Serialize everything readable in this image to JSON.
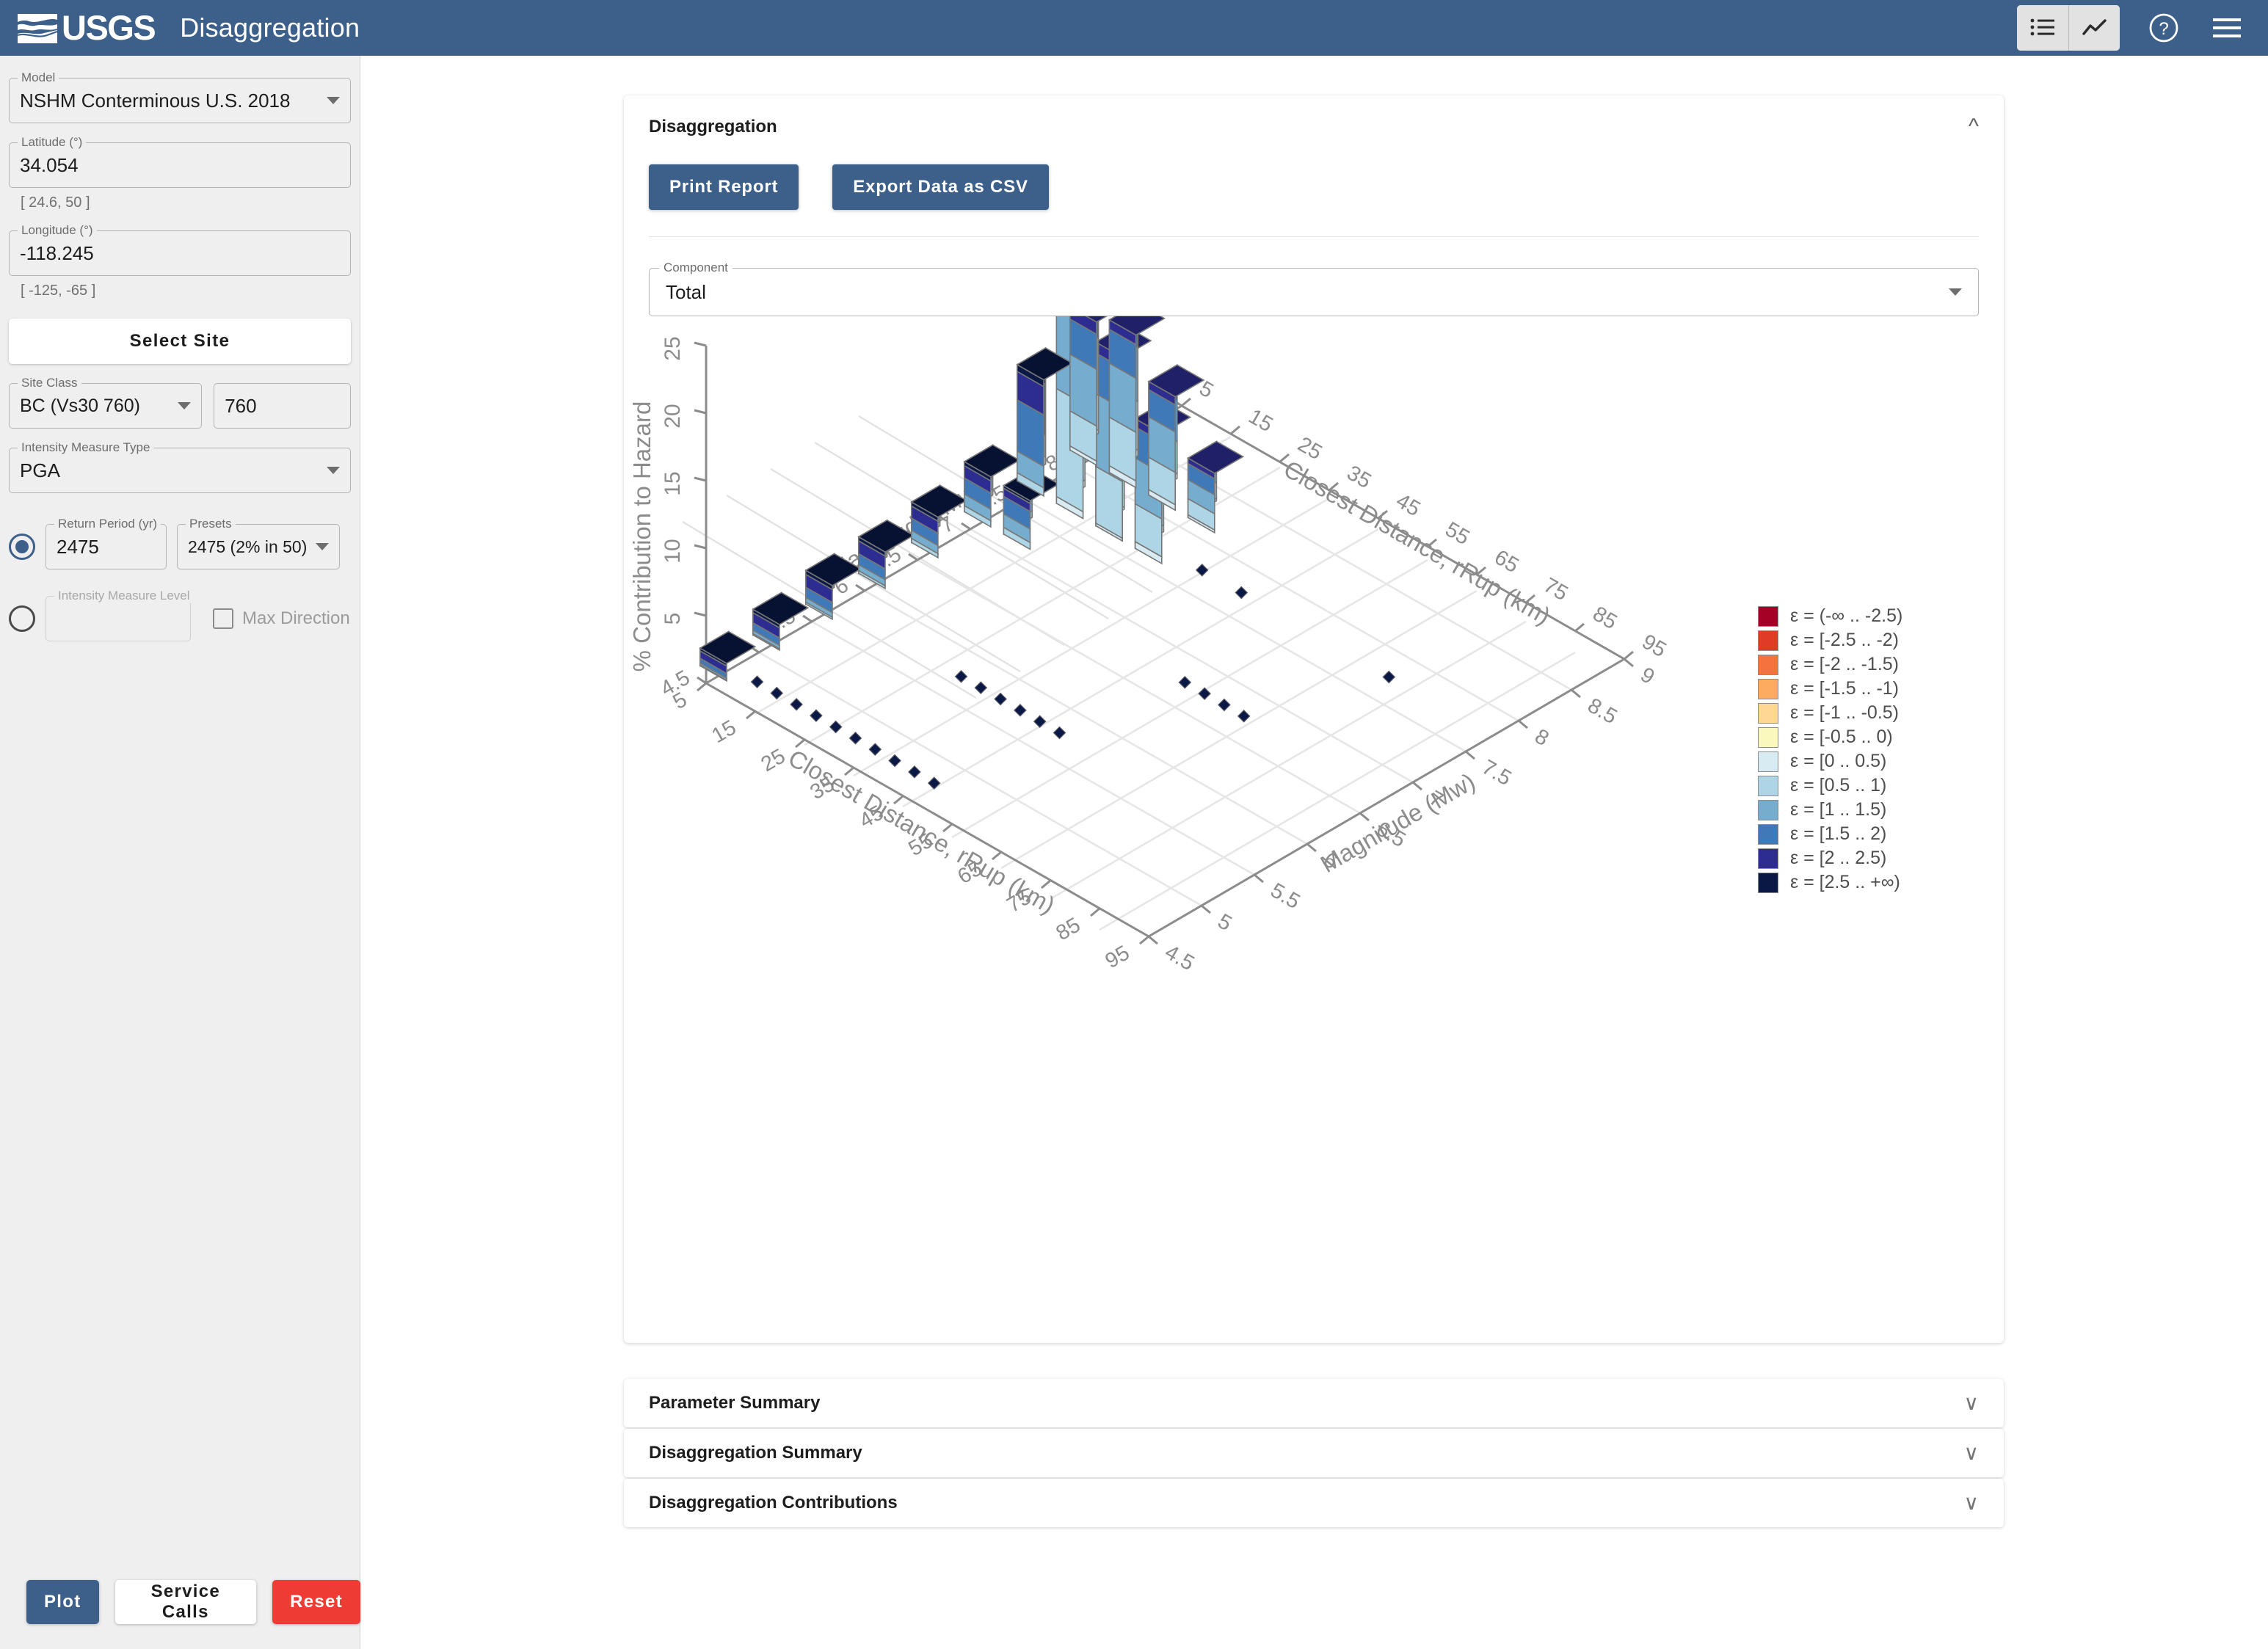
{
  "header": {
    "logo_text": "USGS",
    "title": "Disaggregation",
    "view_toggle": [
      {
        "name": "list-view",
        "icon": "list-icon",
        "active": true
      },
      {
        "name": "chart-view",
        "icon": "line-chart-icon",
        "active": false
      }
    ],
    "help_icon": "help-circle-icon",
    "menu_icon": "hamburger-menu-icon"
  },
  "sidebar": {
    "model": {
      "label": "Model",
      "value": "NSHM Conterminous U.S. 2018"
    },
    "latitude": {
      "label": "Latitude (°)",
      "value": "34.054",
      "hint": "[ 24.6, 50 ]"
    },
    "longitude": {
      "label": "Longitude (°)",
      "value": "-118.245",
      "hint": "[ -125, -65 ]"
    },
    "select_site_label": "Select Site",
    "site_class": {
      "label": "Site Class",
      "value": "BC (Vs30 760)"
    },
    "vs30": {
      "value": "760"
    },
    "imt": {
      "label": "Intensity Measure Type",
      "value": "PGA"
    },
    "return_period": {
      "label": "Return Period (yr)",
      "value": "2475",
      "selected": true
    },
    "presets": {
      "label": "Presets",
      "value": "2475 (2% in 50)"
    },
    "iml": {
      "label": "Intensity Measure Level",
      "value": "",
      "selected": false
    },
    "max_direction": {
      "label": "Max Direction",
      "checked": false
    },
    "footer": {
      "plot_label": "Plot",
      "service_calls_label": "Service Calls",
      "reset_label": "Reset"
    }
  },
  "main": {
    "disagg_card": {
      "title": "Disaggregation",
      "collapse_icon": "chevron-up-icon",
      "print_report_label": "Print Report",
      "export_csv_label": "Export Data as CSV",
      "component": {
        "label": "Component",
        "value": "Total"
      }
    },
    "accordions": [
      {
        "title": "Parameter Summary",
        "icon": "chevron-down-icon"
      },
      {
        "title": "Disaggregation Summary",
        "icon": "chevron-down-icon"
      },
      {
        "title": "Disaggregation Contributions",
        "icon": "chevron-down-icon"
      }
    ]
  },
  "chart_data": {
    "type": "bar",
    "title": "",
    "zlabel": "% Contribution to Hazard",
    "xlabel": "Closest Distance, rRup (km)",
    "ylabel": "Magnitude (Mw)",
    "zlim": [
      0,
      25
    ],
    "zticks": [
      5,
      10,
      15,
      20,
      25
    ],
    "x_ticks_front": [
      5,
      15,
      25,
      35,
      45,
      55,
      65,
      75,
      85,
      95
    ],
    "y_ticks_front": [
      4.5,
      5,
      5.5,
      6,
      6.5,
      7,
      7.5,
      8,
      8.5,
      9
    ],
    "y_ticks_left": [
      4.5,
      5,
      5.5,
      6,
      6.5,
      7,
      7.5,
      8,
      8.5,
      9
    ],
    "x_ticks_right": [
      5,
      15,
      25,
      35,
      45,
      55,
      65,
      75,
      85,
      95
    ],
    "grid": true,
    "legend_position": "right",
    "legend_title": "",
    "eps_bins": [
      {
        "label": "ε = (-∞ .. -2.5)",
        "color": "#a50026"
      },
      {
        "label": "ε = [-2.5 .. -2)",
        "color": "#df3b26"
      },
      {
        "label": "ε = [-2 .. -1.5)",
        "color": "#f5713d"
      },
      {
        "label": "ε = [-1.5 .. -1)",
        "color": "#fcab60"
      },
      {
        "label": "ε = [-1 .. -0.5)",
        "color": "#fed792"
      },
      {
        "label": "ε = [-0.5 .. 0)",
        "color": "#fbf8bd"
      },
      {
        "label": "ε = [0 .. 0.5)",
        "color": "#d8eaf2"
      },
      {
        "label": "ε = [0.5 .. 1)",
        "color": "#aed5e6"
      },
      {
        "label": "ε = [1 .. 1.5)",
        "color": "#76adcf"
      },
      {
        "label": "ε = [1.5 .. 2)",
        "color": "#3f79b7"
      },
      {
        "label": "ε = [2 .. 2.5)",
        "color": "#2d2d91"
      },
      {
        "label": "ε = [2.5 .. +∞)",
        "color": "#0a1845"
      }
    ],
    "bars": [
      {
        "r": 4,
        "m": 4.75,
        "total": 1.3,
        "segs": [
          [
            7,
            0.05
          ],
          [
            8,
            0.15
          ],
          [
            9,
            0.35
          ],
          [
            10,
            0.55
          ],
          [
            11,
            0.2
          ]
        ]
      },
      {
        "r": 4,
        "m": 5.25,
        "total": 1.9,
        "segs": [
          [
            7,
            0.1
          ],
          [
            8,
            0.25
          ],
          [
            9,
            0.55
          ],
          [
            10,
            0.75
          ],
          [
            11,
            0.25
          ]
        ]
      },
      {
        "r": 4,
        "m": 5.75,
        "total": 2.5,
        "segs": [
          [
            7,
            0.15
          ],
          [
            8,
            0.35
          ],
          [
            9,
            0.75
          ],
          [
            10,
            0.95
          ],
          [
            11,
            0.3
          ]
        ]
      },
      {
        "r": 4,
        "m": 6.25,
        "total": 2.7,
        "segs": [
          [
            7,
            0.2
          ],
          [
            8,
            0.45
          ],
          [
            9,
            0.8
          ],
          [
            10,
            0.95
          ],
          [
            11,
            0.3
          ]
        ]
      },
      {
        "r": 4,
        "m": 6.75,
        "total": 3.0,
        "segs": [
          [
            7,
            0.3
          ],
          [
            8,
            0.6
          ],
          [
            9,
            0.9
          ],
          [
            10,
            0.9
          ],
          [
            11,
            0.3
          ]
        ]
      },
      {
        "r": 4,
        "m": 7.25,
        "total": 3.7,
        "segs": [
          [
            7,
            0.45
          ],
          [
            8,
            0.85
          ],
          [
            9,
            1.2
          ],
          [
            10,
            0.9
          ],
          [
            11,
            0.3
          ]
        ]
      },
      {
        "r": 4,
        "m": 7.75,
        "total": 8.6,
        "segs": [
          [
            7,
            0.6
          ],
          [
            8,
            1.6
          ],
          [
            9,
            3.8
          ],
          [
            10,
            2.1
          ],
          [
            11,
            0.5
          ]
        ]
      },
      {
        "r": 4,
        "m": 8.25,
        "total": 10.6,
        "segs": [
          [
            6,
            0.3
          ],
          [
            7,
            2.6
          ],
          [
            8,
            4.2
          ],
          [
            9,
            2.6
          ],
          [
            10,
            0.9
          ]
        ]
      },
      {
        "r": 12,
        "m": 7.25,
        "total": 3.6,
        "segs": [
          [
            7,
            0.5
          ],
          [
            8,
            1.0
          ],
          [
            9,
            1.3
          ],
          [
            10,
            0.6
          ],
          [
            11,
            0.2
          ]
        ]
      },
      {
        "r": 12,
        "m": 7.75,
        "total": 21.5,
        "segs": [
          [
            6,
            0.5
          ],
          [
            7,
            8.0
          ],
          [
            8,
            8.5
          ],
          [
            9,
            3.6
          ],
          [
            10,
            0.9
          ]
        ]
      },
      {
        "r": 12,
        "m": 8.25,
        "total": 11.3,
        "segs": [
          [
            6,
            0.5
          ],
          [
            7,
            3.6
          ],
          [
            8,
            4.0
          ],
          [
            9,
            2.5
          ],
          [
            10,
            0.7
          ]
        ]
      },
      {
        "r": 20,
        "m": 7.75,
        "total": 13.6,
        "segs": [
          [
            6,
            0.2
          ],
          [
            7,
            4.2
          ],
          [
            8,
            5.4
          ],
          [
            9,
            3.0
          ],
          [
            10,
            0.8
          ]
        ]
      },
      {
        "r": 20,
        "m": 8.25,
        "total": 8.4,
        "segs": [
          [
            6,
            0.4
          ],
          [
            7,
            2.4
          ],
          [
            8,
            3.0
          ],
          [
            9,
            2.0
          ],
          [
            10,
            0.6
          ]
        ]
      },
      {
        "r": 28,
        "m": 7.75,
        "total": 9.6,
        "segs": [
          [
            6,
            0.5
          ],
          [
            7,
            2.8
          ],
          [
            8,
            3.4
          ],
          [
            9,
            2.3
          ],
          [
            10,
            0.6
          ]
        ]
      },
      {
        "r": 28,
        "m": 8.25,
        "total": 4.4,
        "segs": [
          [
            6,
            0.2
          ],
          [
            7,
            1.2
          ],
          [
            8,
            1.4
          ],
          [
            9,
            1.2
          ],
          [
            10,
            0.4
          ]
        ]
      }
    ],
    "markers": [
      {
        "r": 36,
        "m": 7.75
      },
      {
        "r": 44,
        "m": 7.75
      },
      {
        "r": 10,
        "m": 4.75
      },
      {
        "r": 14,
        "m": 4.75
      },
      {
        "r": 18,
        "m": 4.75
      },
      {
        "r": 22,
        "m": 4.75
      },
      {
        "r": 26,
        "m": 4.75
      },
      {
        "r": 30,
        "m": 4.75
      },
      {
        "r": 34,
        "m": 4.75
      },
      {
        "r": 38,
        "m": 4.75
      },
      {
        "r": 42,
        "m": 4.75
      },
      {
        "r": 46,
        "m": 4.75
      },
      {
        "r": 30,
        "m": 5.75
      },
      {
        "r": 34,
        "m": 5.75
      },
      {
        "r": 38,
        "m": 5.75
      },
      {
        "r": 42,
        "m": 5.75
      },
      {
        "r": 46,
        "m": 5.75
      },
      {
        "r": 50,
        "m": 5.75
      },
      {
        "r": 54,
        "m": 6.75
      },
      {
        "r": 58,
        "m": 6.75
      },
      {
        "r": 62,
        "m": 6.75
      },
      {
        "r": 66,
        "m": 6.75
      },
      {
        "r": 74,
        "m": 7.75
      }
    ]
  }
}
